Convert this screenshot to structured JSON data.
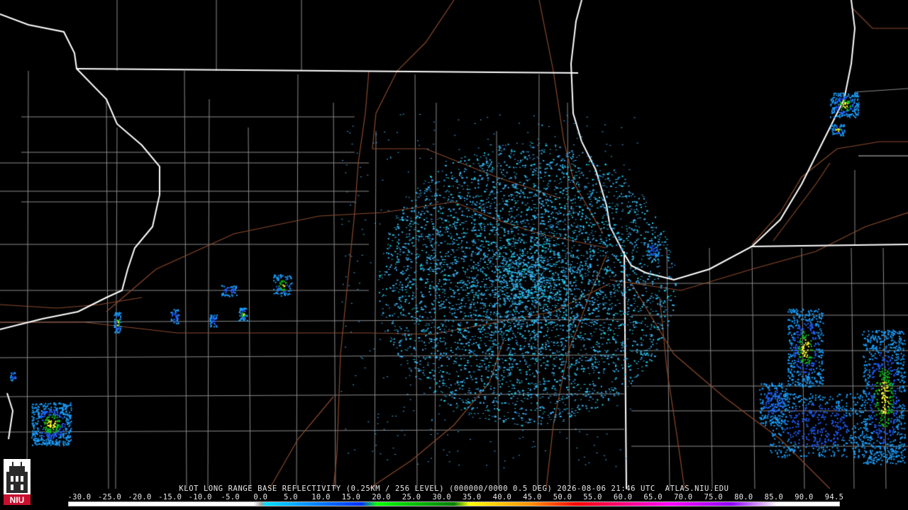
{
  "product": {
    "caption": "KLOT LONG RANGE BASE REFLECTIVITY (0.25KM / 256 LEVEL) (000000/0000 0.5 DEG) 2026-08-06 21:46 UTC  ATLAS.NIU.EDU"
  },
  "legend": {
    "labels": [
      "-30.0",
      "-25.0",
      "-20.0",
      "-15.0",
      "-10.0",
      "-5.0",
      "0.0",
      "5.0",
      "10.0",
      "15.0",
      "20.0",
      "25.0",
      "30.0",
      "35.0",
      "40.0",
      "45.0",
      "50.0",
      "55.0",
      "60.0",
      "65.0",
      "70.0",
      "75.0",
      "80.0",
      "85.0",
      "90.0",
      "94.5"
    ],
    "colors": {
      "low": "#ffffff",
      "cyan": "#00e0ff",
      "blue": "#0030ff",
      "green": "#00ff00",
      "dark_green": "#008000",
      "yellow": "#ffff00",
      "orange": "#ff9000",
      "red": "#ff0000",
      "magenta": "#ff00ff",
      "purple": "#9000ff",
      "high": "#ffffff"
    }
  },
  "map": {
    "radar_site": "KLOT",
    "colors": {
      "state_border": "#ffffff",
      "county_line": "#8a8a8a",
      "highway": "#8b4a2c",
      "echo_light": "#3aaef0",
      "echo_cyan": "#18d8f0"
    }
  },
  "logo": {
    "text": "NIU"
  }
}
